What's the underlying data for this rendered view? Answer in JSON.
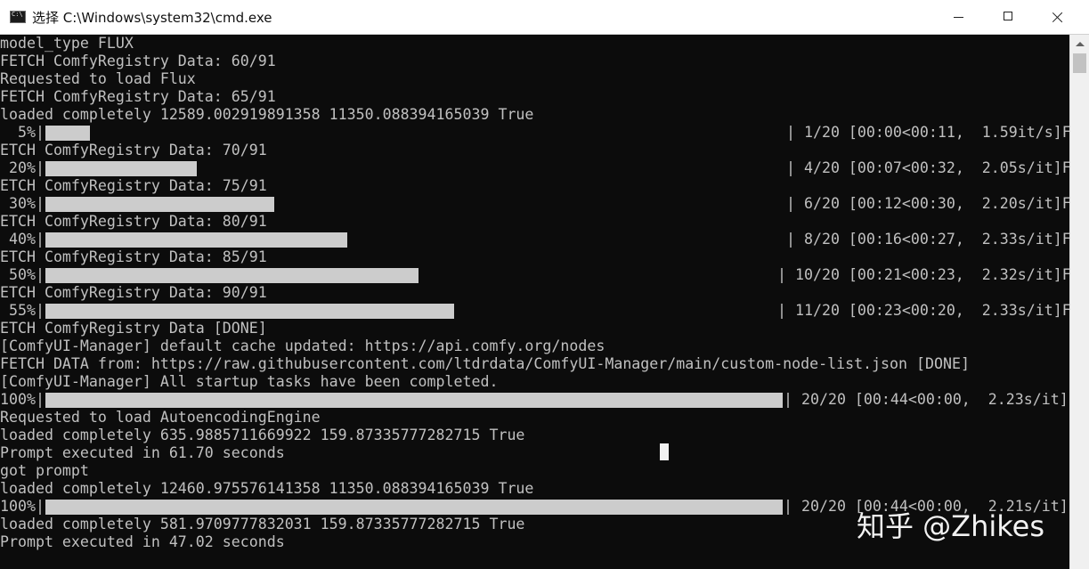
{
  "window": {
    "title": "选择 C:\\Windows\\system32\\cmd.exe",
    "icon": "cmd-app-icon",
    "controls": {
      "minimize": "minimize-icon",
      "maximize": "maximize-icon",
      "close": "close-icon"
    }
  },
  "console": {
    "lines": [
      {
        "text": "model_type FLUX"
      },
      {
        "text": "FETCH ComfyRegistry Data: 60/91"
      },
      {
        "text": "Requested to load Flux"
      },
      {
        "text": "FETCH ComfyRegistry Data: 65/91"
      },
      {
        "text": "loaded completely 12589.002919891358 11350.088394165039 True"
      },
      {
        "pct": "  5%|",
        "progress": 0.06,
        "stats": "| 1/20 [00:00<00:11,  1.59it/s]F"
      },
      {
        "text": "ETCH ComfyRegistry Data: 70/91"
      },
      {
        "pct": " 20%|",
        "progress": 0.205,
        "stats": "| 4/20 [00:07<00:32,  2.05s/it]F"
      },
      {
        "text": "ETCH ComfyRegistry Data: 75/91"
      },
      {
        "pct": " 30%|",
        "progress": 0.31,
        "stats": "| 6/20 [00:12<00:30,  2.20s/it]F"
      },
      {
        "text": "ETCH ComfyRegistry Data: 80/91"
      },
      {
        "pct": " 40%|",
        "progress": 0.41,
        "stats": "| 8/20 [00:16<00:27,  2.33s/it]F"
      },
      {
        "text": "ETCH ComfyRegistry Data: 85/91"
      },
      {
        "pct": " 50%|",
        "progress": 0.506,
        "stats": "| 10/20 [00:21<00:23,  2.32s/it]F"
      },
      {
        "text": "ETCH ComfyRegistry Data: 90/91"
      },
      {
        "pct": " 55%|",
        "progress": 0.554,
        "stats": "| 11/20 [00:23<00:20,  2.33s/it]F"
      },
      {
        "text": "ETCH ComfyRegistry Data [DONE]"
      },
      {
        "text": "[ComfyUI-Manager] default cache updated: https://api.comfy.org/nodes"
      },
      {
        "text": "FETCH DATA from: https://raw.githubusercontent.com/ltdrdata/ComfyUI-Manager/main/custom-node-list.json [DONE]"
      },
      {
        "text": "[ComfyUI-Manager] All startup tasks have been completed."
      },
      {
        "pct": "100%|",
        "progress": 1.0,
        "stats": "| 20/20 [00:44<00:00,  2.23s/it]"
      },
      {
        "text": "Requested to load AutoencodingEngine"
      },
      {
        "text": "loaded completely 635.9885711669922 159.87335777282715 True"
      },
      {
        "text": "Prompt executed in 61.70 seconds"
      },
      {
        "text": "got prompt"
      },
      {
        "text": "loaded completely 12460.975576141358 11350.088394165039 True"
      },
      {
        "pct": "100%|",
        "progress": 1.0,
        "stats": "| 20/20 [00:44<00:00,  2.21s/it]"
      },
      {
        "text": "loaded completely 581.9709777832031 159.87335777282715 True"
      },
      {
        "text": "Prompt executed in 47.02 seconds"
      }
    ]
  },
  "watermark": "知乎 @Zhikes",
  "colors": {
    "background": "#0c0c0c",
    "text": "#c0c0c0",
    "bar": "#cccccc",
    "titlebar": "#ffffff"
  }
}
